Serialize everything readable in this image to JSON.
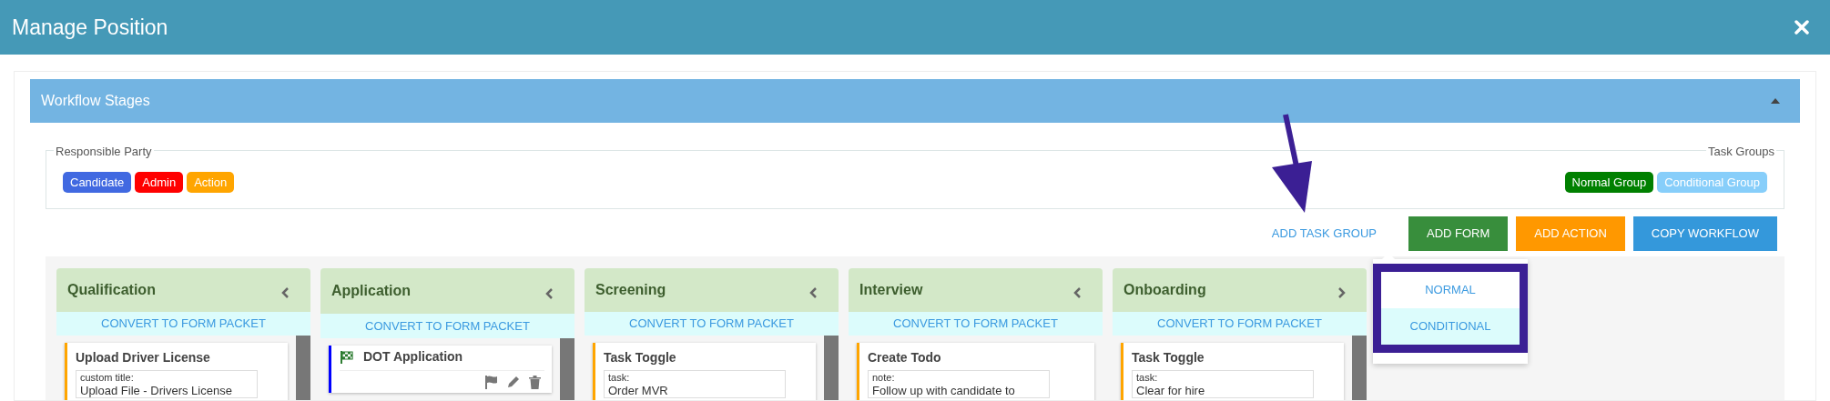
{
  "window": {
    "title": "Manage Position"
  },
  "panel": {
    "title": "Workflow Stages",
    "expanded": true
  },
  "legend": {
    "responsible_party": {
      "label": "Responsible Party",
      "badges": [
        {
          "label": "Candidate",
          "color": "#4169e1"
        },
        {
          "label": "Admin",
          "color": "#ff0000"
        },
        {
          "label": "Action",
          "color": "#ffa500"
        }
      ]
    },
    "task_groups": {
      "label": "Task Groups",
      "badges": [
        {
          "label": "Normal Group",
          "color": "#008000"
        },
        {
          "label": "Conditional Group",
          "color": "#87cefa"
        }
      ]
    }
  },
  "toolbar": {
    "link": "ADD TASK GROUP",
    "buttons": [
      {
        "label": "ADD FORM",
        "color": "#388e3c"
      },
      {
        "label": "ADD ACTION",
        "color": "#ff9800"
      },
      {
        "label": "COPY WORKFLOW",
        "color": "#3498db"
      }
    ]
  },
  "dropdown": {
    "items": [
      {
        "label": "NORMAL",
        "selected": false
      },
      {
        "label": "CONDITIONAL",
        "selected": true
      }
    ]
  },
  "stages": [
    {
      "title": "Qualification",
      "points_left": true,
      "convert": "CONVERT TO FORM PACKET",
      "scrollbar": true,
      "cards": [
        {
          "kind": "field",
          "title": "Upload Driver License",
          "color": "#ffa500",
          "field_label": "custom title:",
          "field_value": "Upload File - Drivers License"
        }
      ]
    },
    {
      "title": "Application",
      "points_left": true,
      "convert": "CONVERT TO FORM PACKET",
      "scrollbar": true,
      "cards": [
        {
          "kind": "form",
          "title": "DOT Application",
          "color": "#0000ff"
        }
      ]
    },
    {
      "title": "Screening",
      "points_left": true,
      "convert": "CONVERT TO FORM PACKET",
      "scrollbar": true,
      "cards": [
        {
          "kind": "field",
          "title": "Task Toggle",
          "color": "#ffa500",
          "field_label": "task:",
          "field_value": "Order MVR"
        }
      ]
    },
    {
      "title": "Interview",
      "points_left": true,
      "convert": "CONVERT TO FORM PACKET",
      "scrollbar": false,
      "cards": [
        {
          "kind": "field",
          "title": "Create Todo",
          "color": "#ffa500",
          "field_label": "note:",
          "field_value": "Follow up with candidate to"
        }
      ]
    },
    {
      "title": "Onboarding",
      "points_left": false,
      "convert": "CONVERT TO FORM PACKET",
      "scrollbar": true,
      "cards": [
        {
          "kind": "field",
          "title": "Task Toggle",
          "color": "#ffa500",
          "field_label": "task:",
          "field_value": "Clear for hire"
        }
      ]
    }
  ]
}
